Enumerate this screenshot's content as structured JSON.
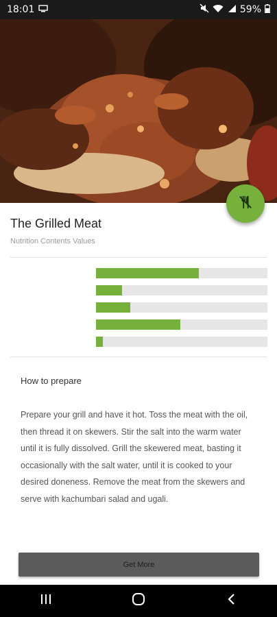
{
  "status_bar": {
    "time": "18:01",
    "battery": "59%"
  },
  "recipe": {
    "title": "The Grilled Meat",
    "subtitle": "Nutrition Contents Values"
  },
  "nutrition_bars": [
    0.6,
    0.15,
    0.2,
    0.49,
    0.04
  ],
  "prepare": {
    "heading": "How to prepare",
    "text": "Prepare your grill and have it hot. Toss the meat with the oil, then thread it on skewers. Stir the salt into the warm water until it is fully dissolved. Grill the skewered meat, basting it occasionally with the salt water, until it is cooked to your desired doneness. Remove the meat from the skewers and serve with kachumbari salad and ugali."
  },
  "button": {
    "label": "Get More"
  },
  "colors": {
    "accent": "#76b13b",
    "button": "#5b5b5b",
    "track": "#e6e6e6"
  },
  "icons": {
    "fab": "fork-knife-icon",
    "status": [
      "screen-icon",
      "mute-icon",
      "wifi-icon",
      "signal-icon",
      "battery-icon"
    ],
    "nav": [
      "recents-icon",
      "home-icon",
      "back-icon"
    ]
  }
}
